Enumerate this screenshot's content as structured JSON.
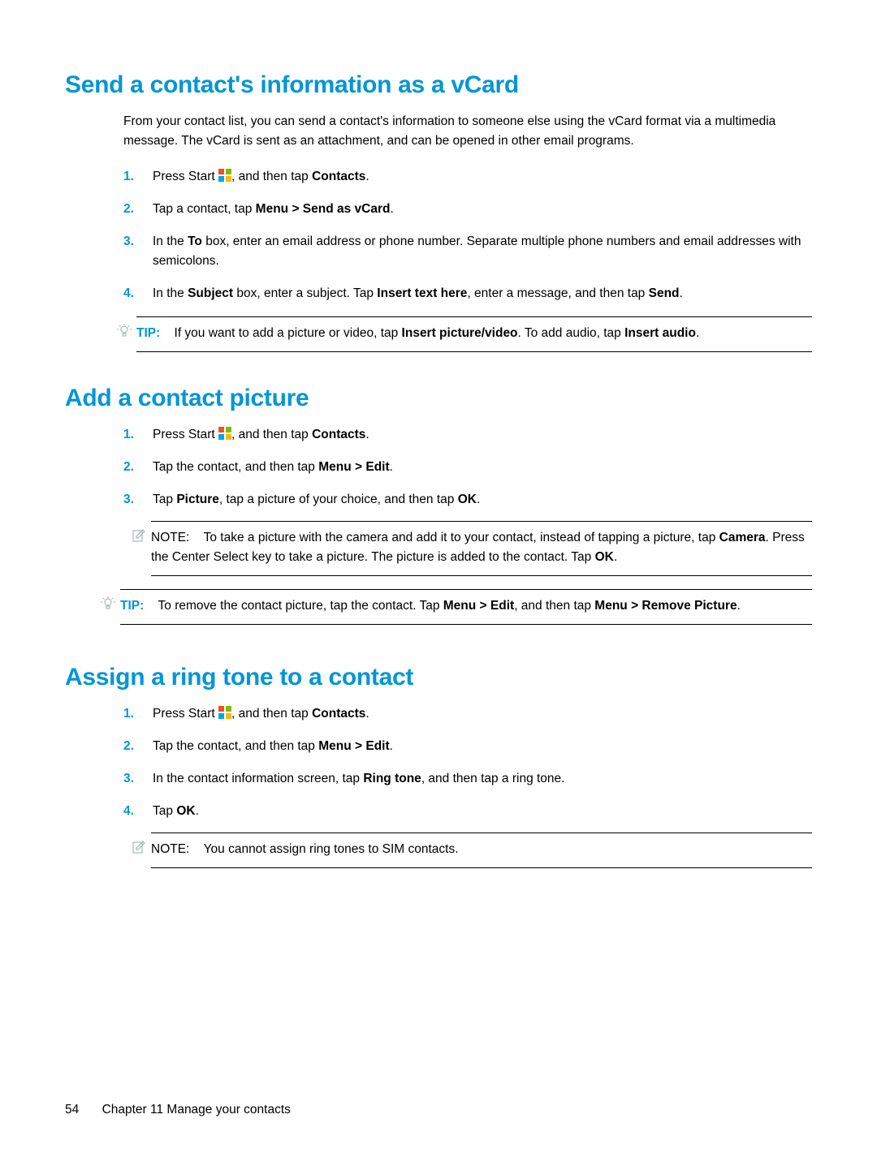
{
  "section1": {
    "heading": "Send a contact's information as a vCard",
    "intro": "From your contact list, you can send a contact's information to someone else using the vCard format via a multimedia message. The vCard is sent as an attachment, and can be opened in other email programs.",
    "step1_a": "Press Start ",
    "step1_b": ", and then tap ",
    "step1_bold": "Contacts",
    "step1_c": ".",
    "step2_a": "Tap a contact, tap ",
    "step2_bold": "Menu > Send as vCard",
    "step2_b": ".",
    "step3_a": "In the ",
    "step3_bold1": "To",
    "step3_b": " box, enter an email address or phone number. Separate multiple phone numbers and email addresses with semicolons.",
    "step4_a": "In the ",
    "step4_bold1": "Subject",
    "step4_b": " box, enter a subject. Tap ",
    "step4_bold2": "Insert text here",
    "step4_c": ", enter a message, and then tap ",
    "step4_bold3": "Send",
    "step4_d": ".",
    "tip_label": "TIP:",
    "tip_a": "If you want to add a picture or video, tap ",
    "tip_bold1": "Insert picture/video",
    "tip_b": ". To add audio, tap ",
    "tip_bold2": "Insert audio",
    "tip_c": "."
  },
  "section2": {
    "heading": "Add a contact picture",
    "step1_a": "Press Start ",
    "step1_b": ", and then tap ",
    "step1_bold": "Contacts",
    "step1_c": ".",
    "step2_a": "Tap the contact, and then tap ",
    "step2_bold": "Menu > Edit",
    "step2_b": ".",
    "step3_a": "Tap ",
    "step3_bold1": "Picture",
    "step3_b": ", tap a picture of your choice, and then tap ",
    "step3_bold2": "OK",
    "step3_c": ".",
    "note_label": "NOTE:",
    "note_a": "To take a picture with the camera and add it to your contact, instead of tapping a picture, tap ",
    "note_bold1": "Camera",
    "note_b": ". Press the Center Select key to take a picture. The picture is added to the contact. Tap ",
    "note_bold2": "OK",
    "note_c": ".",
    "tip_label": "TIP:",
    "tip_a": "To remove the contact picture, tap the contact. Tap ",
    "tip_bold1": "Menu > Edit",
    "tip_b": ", and then tap ",
    "tip_bold2": "Menu > Remove Picture",
    "tip_c": "."
  },
  "section3": {
    "heading": "Assign a ring tone to a contact",
    "step1_a": "Press Start ",
    "step1_b": ", and then tap ",
    "step1_bold": "Contacts",
    "step1_c": ".",
    "step2_a": "Tap the contact, and then tap ",
    "step2_bold": "Menu > Edit",
    "step2_b": ".",
    "step3_a": "In the contact information screen, tap ",
    "step3_bold1": "Ring tone",
    "step3_b": ", and then tap a ring tone.",
    "step4_a": "Tap ",
    "step4_bold1": "OK",
    "step4_b": ".",
    "note_label": "NOTE:",
    "note_a": "You cannot assign ring tones to SIM contacts."
  },
  "footer": {
    "page_number": "54",
    "chapter": "Chapter 11   Manage your contacts"
  }
}
